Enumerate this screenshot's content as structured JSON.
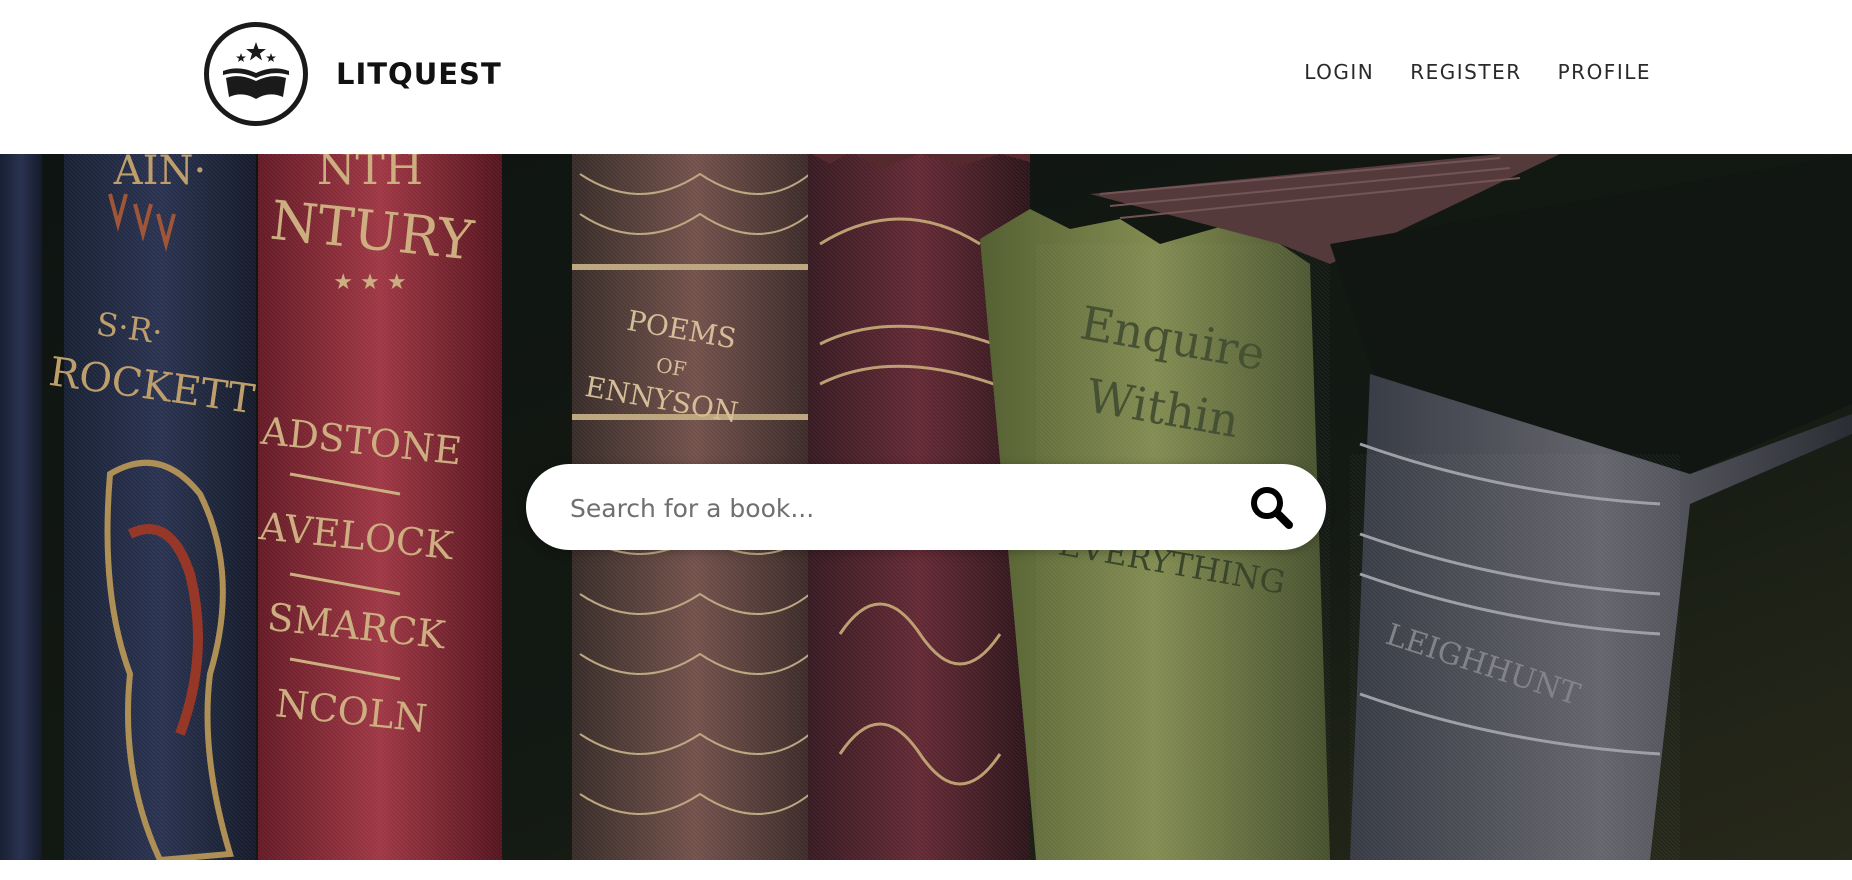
{
  "brand": {
    "name": "LITQUEST",
    "logo_icon": "open-book-stars-icon"
  },
  "nav": {
    "items": [
      {
        "label": "LOGIN"
      },
      {
        "label": "REGISTER"
      },
      {
        "label": "PROFILE"
      }
    ]
  },
  "hero": {
    "background": "antique-book-spines-photo",
    "spine_texts": [
      "S·R·",
      "ROCKETT",
      "NTURY",
      "ADSTONE",
      "AVELOCK",
      "SMARCK",
      "NCOLN",
      "POEMS",
      "OF",
      "ENNYSON",
      "EVERYTHING"
    ]
  },
  "search": {
    "placeholder": "Search for a book...",
    "value": "",
    "button_icon": "search-icon"
  },
  "colors": {
    "header_bg": "#ffffff",
    "text_dark": "#111111",
    "hero_dark": "#1a1e17"
  }
}
